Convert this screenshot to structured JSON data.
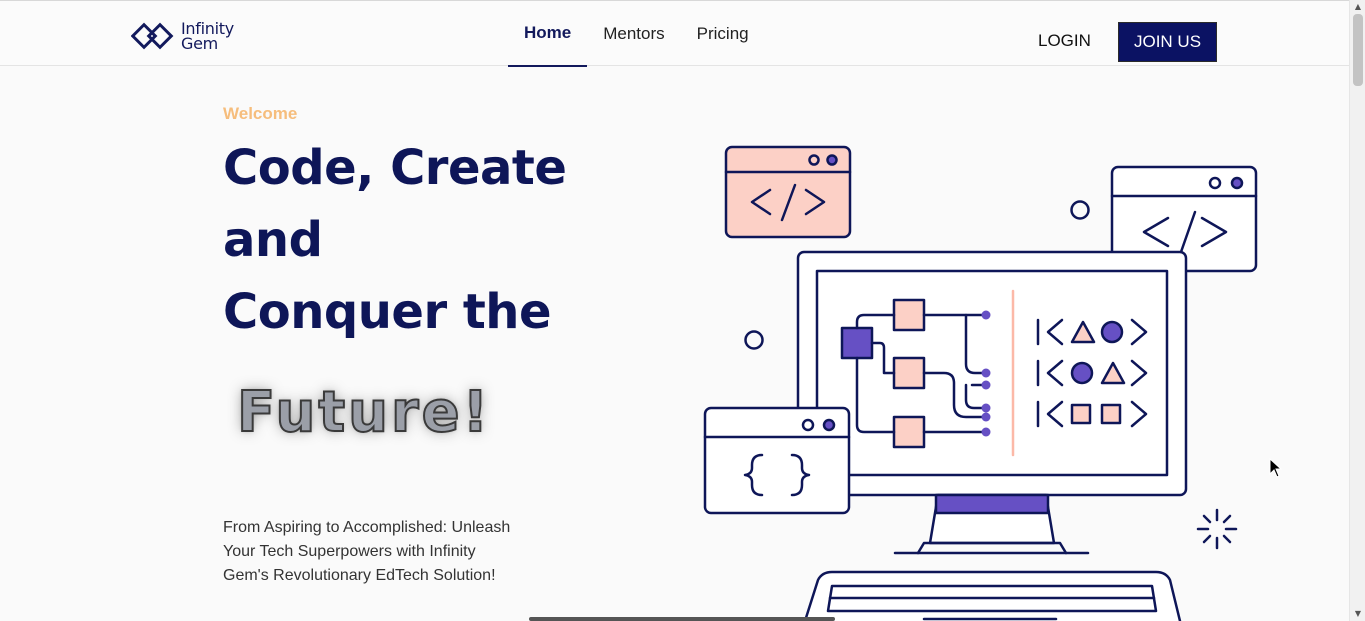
{
  "brand": {
    "name_line1": "Infinity",
    "name_line2": "Gem",
    "color": "#12195c"
  },
  "nav": {
    "items": [
      {
        "label": "Home",
        "active": true
      },
      {
        "label": "Mentors",
        "active": false
      },
      {
        "label": "Pricing",
        "active": false
      }
    ]
  },
  "auth": {
    "login_label": "LOGIN",
    "join_label": "JOIN US"
  },
  "hero": {
    "eyebrow": "Welcome",
    "headline_lines": [
      "Code, Create",
      "and",
      "Conquer the"
    ],
    "highlight_word": "Future!",
    "description": "From Aspiring to Accomplished: Unleash Your Tech Superpowers with Infinity Gem's Revolutionary EdTech Solution!"
  },
  "illustration": {
    "code_glyph": "</>",
    "braces_glyph": "{ }"
  },
  "colors": {
    "navy": "#0e1658",
    "accent": "#f6bd7c",
    "peach": "#fcd0c6",
    "purple": "#6650c4"
  }
}
